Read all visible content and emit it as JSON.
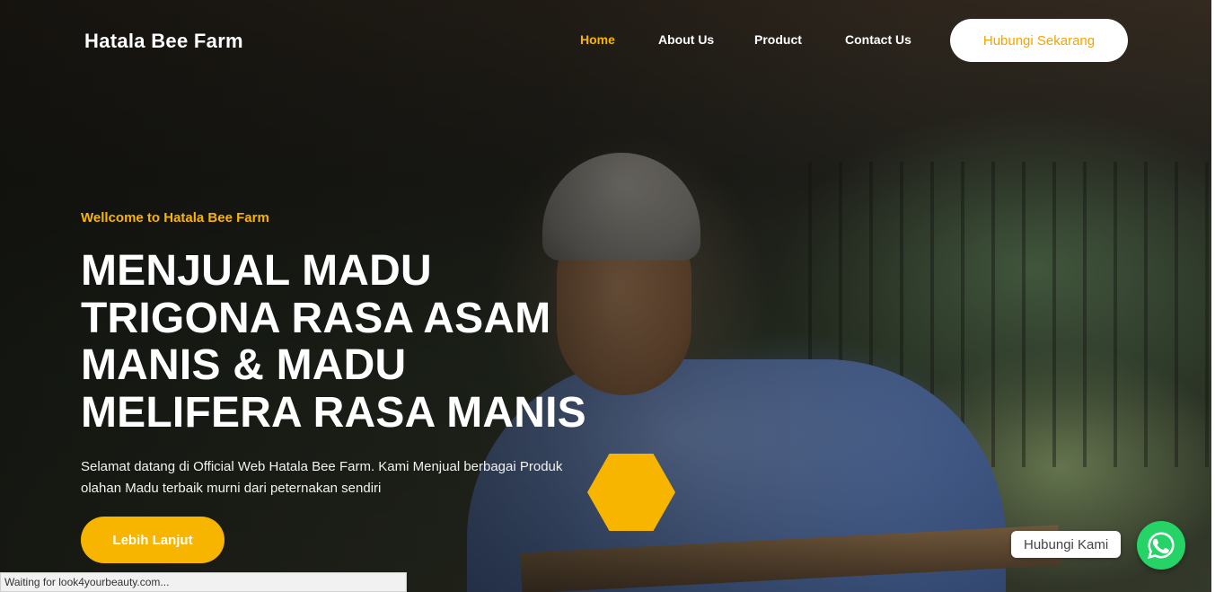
{
  "site": {
    "logo": "Hatala Bee Farm"
  },
  "nav": {
    "items": [
      {
        "label": "Home",
        "active": true
      },
      {
        "label": "About Us",
        "active": false
      },
      {
        "label": "Product",
        "active": false
      },
      {
        "label": "Contact Us",
        "active": false
      }
    ],
    "cta_label": "Hubungi Sekarang"
  },
  "hero": {
    "welcome": "Wellcome to Hatala Bee Farm",
    "headline_lines": [
      "MENJUAL MADU",
      "TRIGONA RASA ASAM",
      "MANIS & MADU",
      "MELIFERA RASA MANIS"
    ],
    "description_lines": [
      "Selamat datang di Official Web Hatala Bee Farm. Kami Menjual berbagai Produk",
      "olahan Madu terbaik murni dari peternakan sendiri"
    ],
    "button_label": "Lebih Lanjut"
  },
  "chat": {
    "label": "Hubungi Kami",
    "icon": "whatsapp-icon"
  },
  "browser_status": "Waiting for look4yourbeauty.com...",
  "colors": {
    "accent": "#f7b500",
    "cta_text": "#f5a300",
    "whatsapp": "#25d366",
    "text_light": "#ffffff"
  }
}
